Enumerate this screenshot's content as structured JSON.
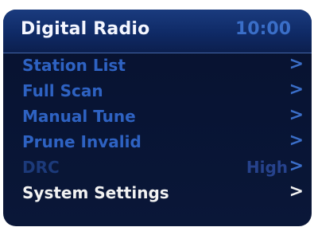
{
  "header": {
    "title": "Digital Radio",
    "time": "10:00"
  },
  "menu": {
    "chevron": ">",
    "items": [
      {
        "label": "Station List"
      },
      {
        "label": "Full Scan"
      },
      {
        "label": "Manual Tune"
      },
      {
        "label": "Prune Invalid"
      },
      {
        "label": "DRC",
        "value": "High"
      },
      {
        "label": "System Settings"
      }
    ]
  },
  "colors": {
    "header_background": "#0f2a66",
    "screen_background": "#07122f",
    "item_text": "#2e62c2",
    "selected_item_text": "#f2f2f2",
    "disabled_item_text": "#1c3a7a"
  }
}
